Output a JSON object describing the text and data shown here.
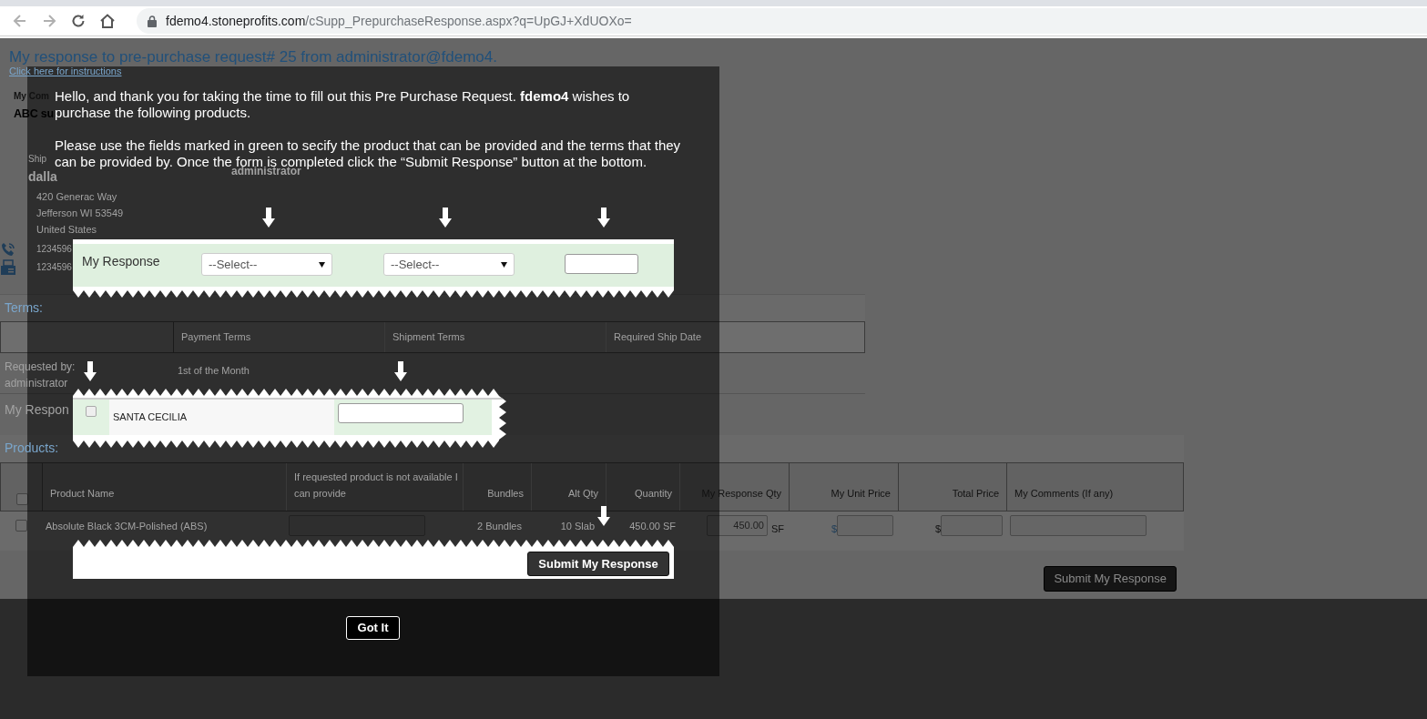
{
  "browser": {
    "url_host": "fdemo4.stoneprofits.com",
    "url_path": "/cSupp_PrepurchaseResponse.aspx?q=UpGJ+XdUOXo="
  },
  "page": {
    "title": "My response to pre-purchase request# 25 from administrator@fdemo4.",
    "instructions_link": "Click here for instructions",
    "company": {
      "label": "My Com",
      "name": "ABC su"
    },
    "ship_to": {
      "label": "Ship",
      "name": "dalla",
      "address": [
        "420 Generac Way",
        "Jefferson WI 53549",
        "United States"
      ],
      "phone": "1234596",
      "fax": "1234596"
    },
    "requested_by_name": "administrator",
    "terms": {
      "heading": "Terms:",
      "columns": [
        "Payment Terms",
        "Shipment Terms",
        "Required Ship Date"
      ],
      "requested_by_label": "Requested by:",
      "requested_by_name": "administrator",
      "payment_terms": "1st of the Month"
    },
    "my_response_label": "My Respon",
    "products": {
      "heading": "Products:",
      "select_all_checked": false,
      "columns": [
        "Product Name",
        "If requested product is not available I can provide",
        "Bundles",
        "Alt Qty",
        "Quantity",
        "My Response Qty",
        "My Unit Price",
        "Total Price",
        "My Comments (If any)"
      ],
      "rows": [
        {
          "checked": false,
          "product_name": "Absolute Black 3CM-Polished (ABS)",
          "bundles": "2 Bundles",
          "alt_qty": "10 Slab",
          "quantity": "450.00 SF",
          "response_qty": "450.00",
          "response_unit": "SF",
          "unit_price_currency": "$",
          "total_price_currency": "$"
        }
      ]
    },
    "submit_button": "Submit My Response"
  },
  "tutorial": {
    "paragraphs": [
      "Hello, and thank you for taking the time to fill out this Pre Purchase Request. **fdemo4** wishes to purchase the following products.",
      "Please use the fields marked in green to secify the product that can be provided and the terms that they can be provided by. Once the form is completed click the “Submit Response” button at the bottom."
    ],
    "terms_example": {
      "label": "My Response",
      "selects": [
        {
          "placeholder": "--Select--"
        },
        {
          "placeholder": "--Select--"
        }
      ]
    },
    "vendor_example": {
      "checked": false,
      "name": "SANTA CECILIA"
    },
    "submit_example": "Submit My Response",
    "got_it": "Got It"
  }
}
